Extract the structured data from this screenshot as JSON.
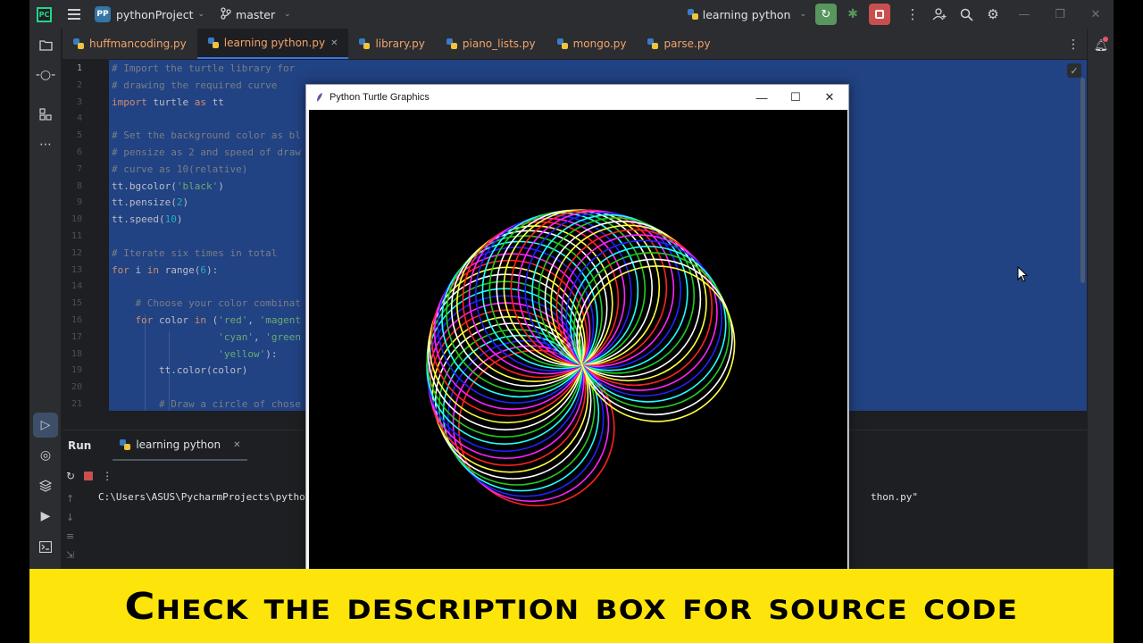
{
  "titlebar": {
    "project_badge": "PP",
    "project_name": "pythonProject",
    "branch": "master",
    "run_config": "learning python"
  },
  "tabs": [
    {
      "label": "huffmancoding.py",
      "active": false
    },
    {
      "label": "learning python.py",
      "active": true
    },
    {
      "label": "library.py",
      "active": false
    },
    {
      "label": "piano_lists.py",
      "active": false
    },
    {
      "label": "mongo.py",
      "active": false
    },
    {
      "label": "parse.py",
      "active": false
    }
  ],
  "editor": {
    "line_numbers": [
      "1",
      "2",
      "3",
      "4",
      "5",
      "6",
      "7",
      "8",
      "9",
      "10",
      "11",
      "12",
      "13",
      "14",
      "15",
      "16",
      "17",
      "18",
      "19",
      "20",
      "21"
    ],
    "lines": [
      "# Import the turtle library for",
      "# drawing the required curve",
      "import turtle as tt",
      "",
      "# Set the background color as bl",
      "# pensize as 2 and speed of draw",
      "# curve as 10(relative)",
      "tt.bgcolor('black')",
      "tt.pensize(2)",
      "tt.speed(10)",
      "",
      "# Iterate six times in total",
      "for i in range(6):",
      "",
      "    # Choose your color combinat",
      "    for color in ('red', 'magent",
      "                  'cyan', 'green",
      "                  'yellow'):",
      "        tt.color(color)",
      "",
      "        # Draw a circle of chose"
    ]
  },
  "run_panel": {
    "title": "Run",
    "tab_label": "learning python",
    "console_left": "C:\\Users\\ASUS\\PycharmProjects\\pytho",
    "console_right": "thon.py\""
  },
  "turtle_window": {
    "title": "Python Turtle Graphics",
    "rings": 6,
    "colors": [
      "#ff2222",
      "#ff22ff",
      "#2222ff",
      "#22ffff",
      "#22cc22",
      "#ffffff",
      "#ffff44"
    ]
  },
  "banner": {
    "text": "Check the description box for source code"
  }
}
